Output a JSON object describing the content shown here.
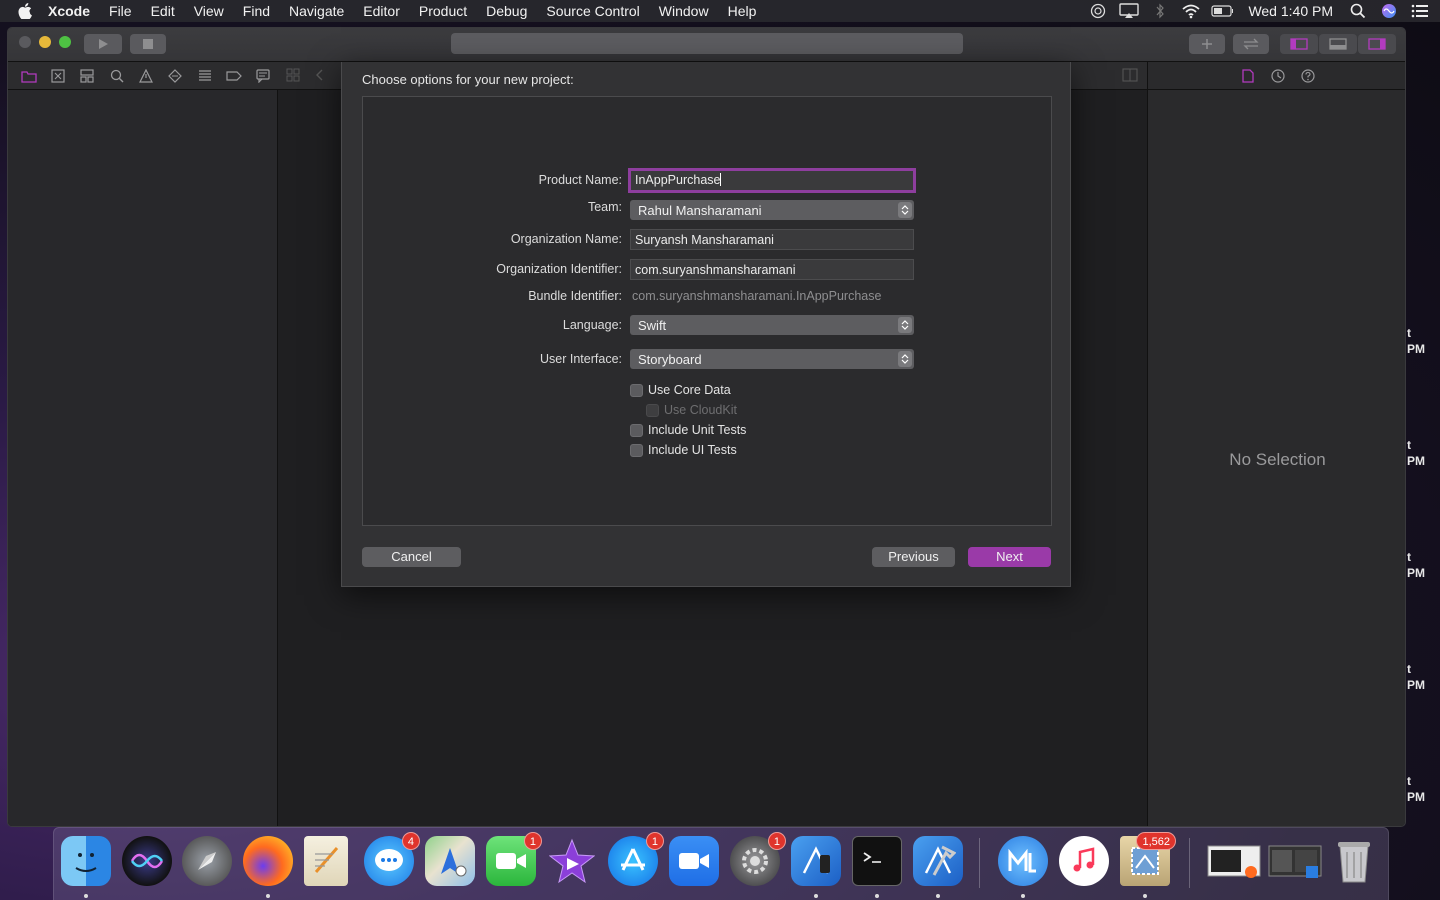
{
  "menubar": {
    "app": "Xcode",
    "items": [
      "File",
      "Edit",
      "View",
      "Find",
      "Navigate",
      "Editor",
      "Product",
      "Debug",
      "Source Control",
      "Window",
      "Help"
    ],
    "status_icons": [
      "focus-icon",
      "airplay-icon",
      "bluetooth-icon",
      "wifi-icon",
      "battery-icon"
    ],
    "clock": "Wed 1:40 PM"
  },
  "sheet": {
    "title": "Choose options for your new project:",
    "fields": {
      "product_name_label": "Product Name:",
      "product_name_value": "InAppPurchase",
      "team_label": "Team:",
      "team_value": "Rahul Mansharamani",
      "org_name_label": "Organization Name:",
      "org_name_value": "Suryansh Mansharamani",
      "org_id_label": "Organization Identifier:",
      "org_id_value": "com.suryanshmansharamani",
      "bundle_id_label": "Bundle Identifier:",
      "bundle_id_value": "com.suryanshmansharamani.InAppPurchase",
      "language_label": "Language:",
      "language_value": "Swift",
      "ui_label": "User Interface:",
      "ui_value": "Storyboard"
    },
    "checkboxes": {
      "core_data": "Use Core Data",
      "cloudkit": "Use CloudKit",
      "unit_tests": "Include Unit Tests",
      "ui_tests": "Include UI Tests"
    },
    "buttons": {
      "cancel": "Cancel",
      "previous": "Previous",
      "next": "Next"
    }
  },
  "inspector": {
    "empty_text": "No Selection"
  },
  "background_stubs": [
    [
      "t",
      "PM"
    ],
    [
      "t",
      "PM"
    ],
    [
      "t",
      "PM"
    ],
    [
      "t",
      "PM"
    ],
    [
      "t",
      "PM"
    ]
  ],
  "dock": {
    "badges": {
      "messages": "4",
      "facetime": "1",
      "app_store": "1",
      "system_preferences": "1",
      "mail": "1,562"
    }
  },
  "colors": {
    "accent": "#9a3aa8",
    "focus_ring": "#8e3e9e",
    "badge": "#e0342c"
  }
}
